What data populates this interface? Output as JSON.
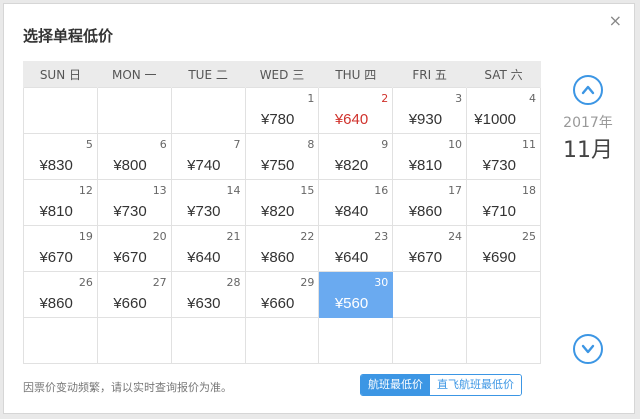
{
  "dialog": {
    "title": "选择单程低价",
    "close_label": "×"
  },
  "weekdays": [
    "SUN 日",
    "MON 一",
    "TUE 二",
    "WED 三",
    "THU 四",
    "FRI 五",
    "SAT 六"
  ],
  "calendar": {
    "rows": [
      [
        {
          "d": "",
          "p": ""
        },
        {
          "d": "",
          "p": ""
        },
        {
          "d": "",
          "p": ""
        },
        {
          "d": "1",
          "p": "¥780"
        },
        {
          "d": "2",
          "p": "¥640"
        },
        {
          "d": "3",
          "p": "¥930"
        },
        {
          "d": "4",
          "p": "¥1000"
        }
      ],
      [
        {
          "d": "5",
          "p": "¥830"
        },
        {
          "d": "6",
          "p": "¥800"
        },
        {
          "d": "7",
          "p": "¥740"
        },
        {
          "d": "8",
          "p": "¥750"
        },
        {
          "d": "9",
          "p": "¥820"
        },
        {
          "d": "10",
          "p": "¥810"
        },
        {
          "d": "11",
          "p": "¥730"
        }
      ],
      [
        {
          "d": "12",
          "p": "¥810"
        },
        {
          "d": "13",
          "p": "¥730"
        },
        {
          "d": "14",
          "p": "¥730"
        },
        {
          "d": "15",
          "p": "¥820"
        },
        {
          "d": "16",
          "p": "¥840"
        },
        {
          "d": "17",
          "p": "¥860"
        },
        {
          "d": "18",
          "p": "¥710"
        }
      ],
      [
        {
          "d": "19",
          "p": "¥670"
        },
        {
          "d": "20",
          "p": "¥670"
        },
        {
          "d": "21",
          "p": "¥640"
        },
        {
          "d": "22",
          "p": "¥860"
        },
        {
          "d": "23",
          "p": "¥640"
        },
        {
          "d": "24",
          "p": "¥670"
        },
        {
          "d": "25",
          "p": "¥690"
        }
      ],
      [
        {
          "d": "26",
          "p": "¥860"
        },
        {
          "d": "27",
          "p": "¥660"
        },
        {
          "d": "28",
          "p": "¥630"
        },
        {
          "d": "29",
          "p": "¥660"
        },
        {
          "d": "30",
          "p": "¥560"
        },
        {
          "d": "",
          "p": ""
        },
        {
          "d": "",
          "p": ""
        }
      ],
      [
        {
          "d": "",
          "p": ""
        },
        {
          "d": "",
          "p": ""
        },
        {
          "d": "",
          "p": ""
        },
        {
          "d": "",
          "p": ""
        },
        {
          "d": "",
          "p": ""
        },
        {
          "d": "",
          "p": ""
        },
        {
          "d": "",
          "p": ""
        }
      ]
    ],
    "highlight_date": "2",
    "selected_date": "30"
  },
  "period": {
    "year": "2017年",
    "month": "11月",
    "prev_icon": "chevron-up-circle-icon",
    "next_icon": "chevron-down-circle-icon"
  },
  "footer": {
    "note": "因票价变动频繁，请以实时查询报价为准。",
    "toggle_options": [
      "航班最低价",
      "直飞航班最低价"
    ],
    "active_option": "航班最低价"
  },
  "colors": {
    "accent": "#3c96e4",
    "selected_bg": "#6aaaf0",
    "highlight_text": "#d0322c",
    "header_bg": "#ebebeb"
  }
}
